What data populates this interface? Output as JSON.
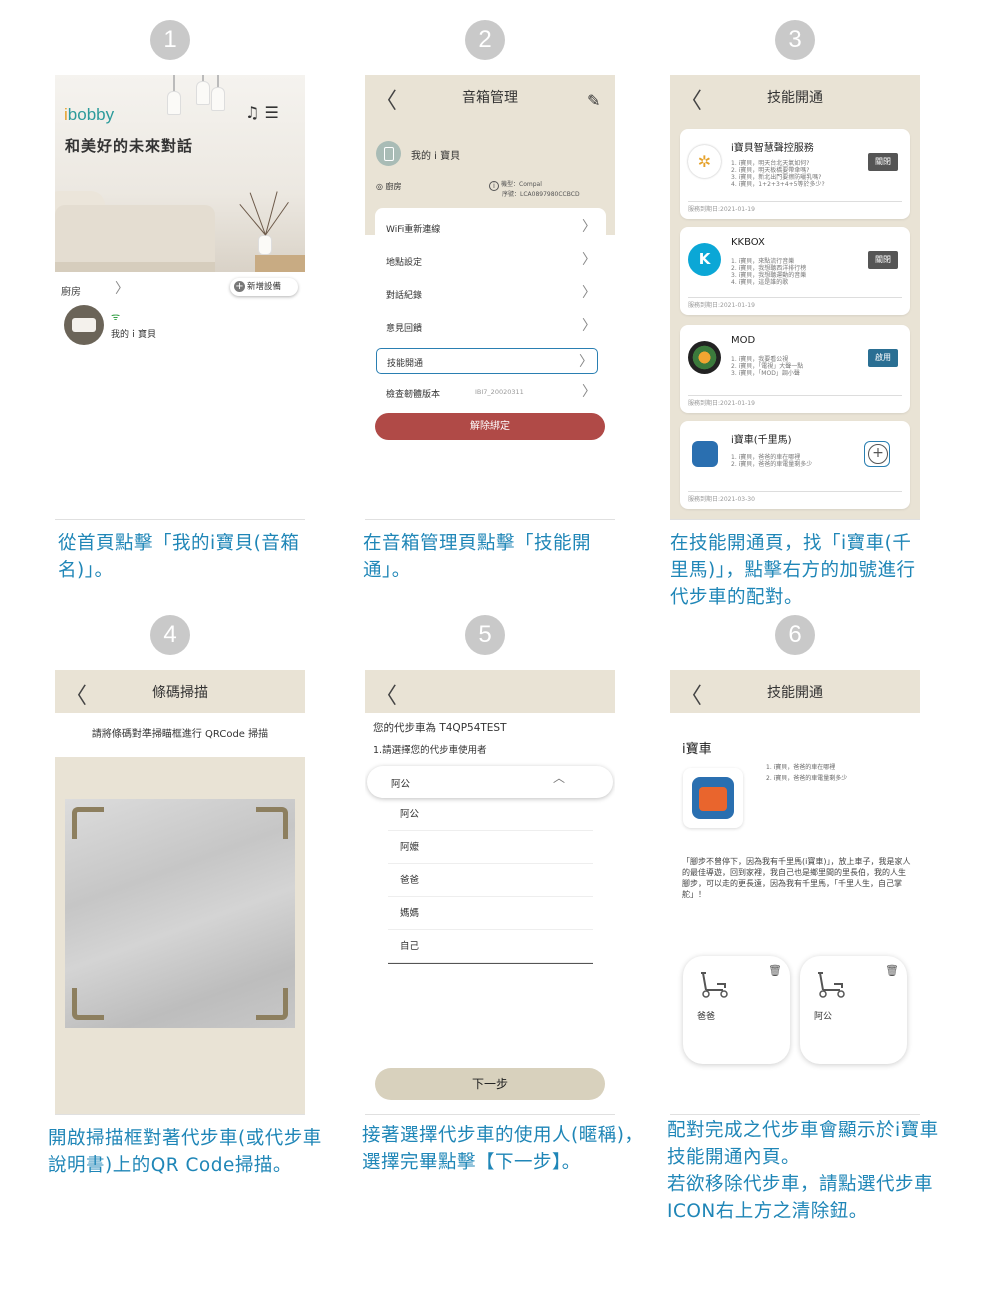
{
  "steps": [
    {
      "num": "1",
      "caption": "從首頁點擊「我的i寶貝(音箱名)」。"
    },
    {
      "num": "2",
      "caption": "在音箱管理頁點擊「技能開通」。"
    },
    {
      "num": "3",
      "caption": "在技能開通頁，找「i寶車(千里馬)」，點擊右方的加號進行代步車的配對。"
    },
    {
      "num": "4",
      "caption": "開啟掃描框對著代步車(或代步車說明書)上的QR Code掃描。"
    },
    {
      "num": "5",
      "caption": "接著選擇代步車的使用人(暱稱)，選擇完畢點擊【下一步】。"
    },
    {
      "num": "6",
      "caption_lines": [
        "配對完成之代步車會顯示於i寶車技能開通內頁。",
        "若欲移除代步車，請點選代步車ICON右上方之清除鈕。"
      ]
    }
  ],
  "screen1": {
    "logo_main": "bobby",
    "logo_i": "i",
    "title": "和美好的未來對話",
    "icons": [
      "music-icon",
      "menu-icon"
    ],
    "room": "廚房",
    "add_device": "新增設備",
    "device_name": "我的ｉ寶貝"
  },
  "screen2": {
    "title": "音箱管理",
    "speaker_name": "我的 i 寶貝",
    "location": "廚房",
    "model_line": "機型：Compal",
    "serial_line": "序號：LCA0897980CCBCD",
    "menu": [
      "WiFi重新連線",
      "地點設定",
      "對話紀錄",
      "意見回饋",
      "技能開通",
      "檢查韌體版本"
    ],
    "firmware_version": "IBI7_20020311",
    "unbind": "解除綁定"
  },
  "screen3": {
    "title": "技能開通",
    "skills": [
      {
        "name": "i寶貝智慧聲控服務",
        "lines": [
          "1. i寶貝，明天台北天氣如何?",
          "2. i寶貝，明天板橋要帶傘嗎?",
          "3. i寶貝，新北出門要擦防曬乳嗎?",
          "4. i寶貝，1+2+3+4+5等於多少?"
        ],
        "button": "關閉",
        "expiry": "服務到期日:2021-01-19"
      },
      {
        "name": "KKBOX",
        "lines": [
          "1. i寶貝，來點流行音樂",
          "2. i寶貝，我想聽西洋排行榜",
          "3. i寶貝，我想聽運動的音樂",
          "4. i寶貝，這是誰的歌"
        ],
        "button": "關閉",
        "expiry": "服務到期日:2021-01-19"
      },
      {
        "name": "MOD",
        "lines": [
          "1. i寶貝，我要看公視",
          "2. i寶貝，「電視」大聲一點",
          "3. i寶貝，「MOD」調小聲"
        ],
        "button": "啟用",
        "expiry": "服務到期日:2021-01-19"
      },
      {
        "name": "i寶車(千里馬)",
        "lines": [
          "1. i寶貝，爸爸的車在哪裡",
          "2. i寶貝，爸爸的車電量剩多少"
        ],
        "expiry": "服務到期日:2021-03-30"
      }
    ]
  },
  "screen4": {
    "title": "條碼掃描",
    "hint": "請將條碼對準掃瞄框進行 QRCode 掃描"
  },
  "screen5": {
    "line1": "您的代步車為 T4QP54TEST",
    "line2": "1.請選擇您的代步車使用者",
    "selected": "阿公",
    "options": [
      "阿公",
      "阿嬤",
      "爸爸",
      "媽媽",
      "自己"
    ],
    "next": "下一步"
  },
  "screen6": {
    "title": "技能開通",
    "skill_name": "i寶車",
    "lines": [
      "1. i寶貝，爸爸的車在哪裡",
      "2. i寶貝，爸爸的車電量剩多少"
    ],
    "description": "「腳步不曾停下，因為我有千里馬(i寶車)」，放上車子，我是家人的最佳導遊，回到家裡，我自己也是鄉里間的里長伯，我的人生腳步，可以走的更長遠，因為我有千里馬，「千里人生，自己掌舵」！",
    "vehicles": [
      "爸爸",
      "阿公"
    ]
  },
  "colors": {
    "caption": "#1f86b7",
    "beige": "#e9e3d5",
    "unbind": "#b04a47",
    "highlight": "#2a7fb2"
  }
}
